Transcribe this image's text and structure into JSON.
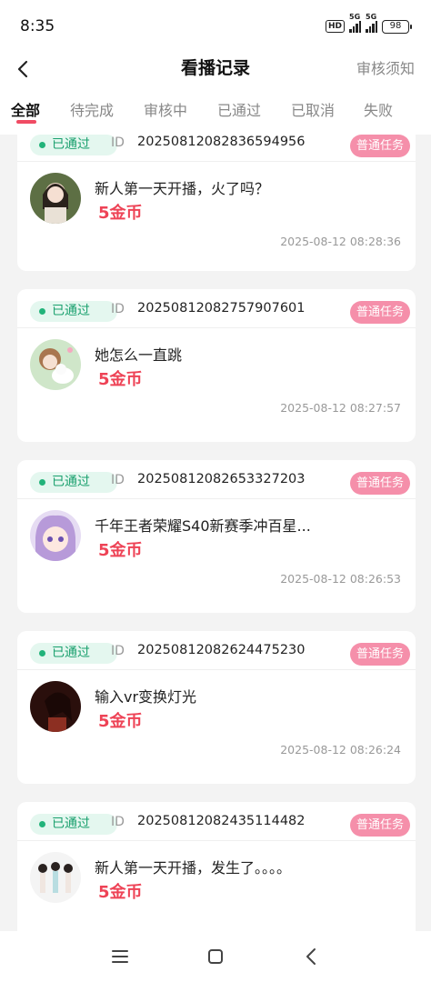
{
  "status_bar": {
    "time": "8:35",
    "hd": "HD",
    "signal1": "5G",
    "signal2": "5G",
    "battery": "98"
  },
  "header": {
    "title": "看播记录",
    "right_link": "审核须知",
    "back_icon": "chevron-left-icon"
  },
  "tabs": [
    {
      "label": "全部",
      "active": true
    },
    {
      "label": "待完成"
    },
    {
      "label": "审核中"
    },
    {
      "label": "已通过"
    },
    {
      "label": "已取消"
    },
    {
      "label": "失败"
    }
  ],
  "records": [
    {
      "status": "已通过",
      "id_label": "ID",
      "id": "20250812082836594956",
      "tag": "普通任务",
      "title": "新人第一天开播，火了吗？",
      "reward": "5金币",
      "time": "2025-08-12 08:28:36"
    },
    {
      "status": "已通过",
      "id_label": "ID",
      "id": "20250812082757907601",
      "tag": "普通任务",
      "title": "她怎么一直跳",
      "reward": "5金币",
      "time": "2025-08-12 08:27:57"
    },
    {
      "status": "已通过",
      "id_label": "ID",
      "id": "20250812082653327203",
      "tag": "普通任务",
      "title": "千年王者荣耀S40新赛季冲百星...",
      "reward": "5金币",
      "time": "2025-08-12 08:26:53"
    },
    {
      "status": "已通过",
      "id_label": "ID",
      "id": "20250812082624475230",
      "tag": "普通任务",
      "title": "输入vr变换灯光",
      "reward": "5金币",
      "time": "2025-08-12 08:26:24"
    },
    {
      "status": "已通过",
      "id_label": "ID",
      "id": "20250812082435114482",
      "tag": "普通任务",
      "title": "新人第一天开播，发生了。。。。",
      "reward": "5金币",
      "time": ""
    }
  ],
  "nav_bar": {
    "menu_icon": "menu-icon",
    "home_icon": "home-icon",
    "back_icon": "back-icon"
  },
  "colors": {
    "accent": "#f04b63",
    "pass_bg": "#e4f7ef",
    "pass_text": "#1aa06e",
    "tag_bg": "#f58faa",
    "coin": "#ee4356"
  }
}
